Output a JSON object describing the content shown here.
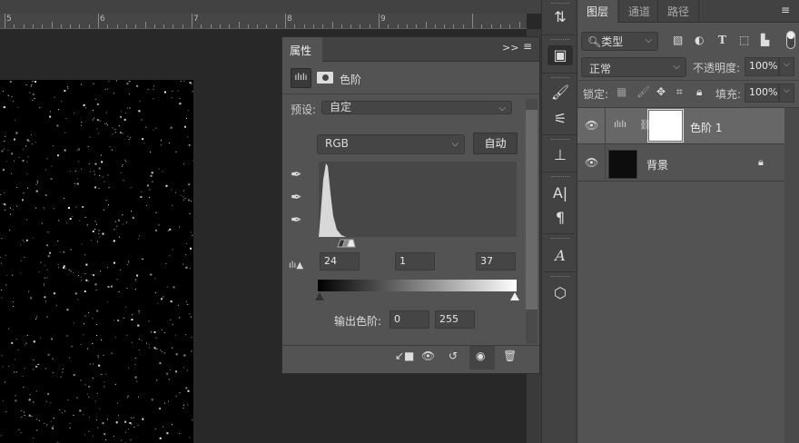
{
  "ruler": {
    "labels": [
      "5",
      "6",
      "7",
      "8",
      "9"
    ]
  },
  "properties": {
    "tab": "属性",
    "title": "色阶",
    "preset_label": "预设:",
    "preset_value": "自定",
    "channel": "RGB",
    "auto_button": "自动",
    "input_levels": {
      "black": "24",
      "gamma": "1",
      "white": "37"
    },
    "output_label": "输出色阶:",
    "output_levels": {
      "black": "0",
      "white": "255"
    }
  },
  "layers_panel": {
    "tabs": [
      "图层",
      "通道",
      "路径"
    ],
    "filter_kind": "类型",
    "blend_mode": "正常",
    "opacity_label": "不透明度:",
    "opacity": "100%",
    "lock_label": "锁定:",
    "fill_label": "填充:",
    "fill": "100%",
    "layers": [
      {
        "name": "色阶 1",
        "type": "adjustment"
      },
      {
        "name": "背景",
        "type": "background"
      }
    ]
  },
  "colors": {
    "canvas": "#000000",
    "panel": "#535353",
    "selected_layer": "#676767"
  }
}
